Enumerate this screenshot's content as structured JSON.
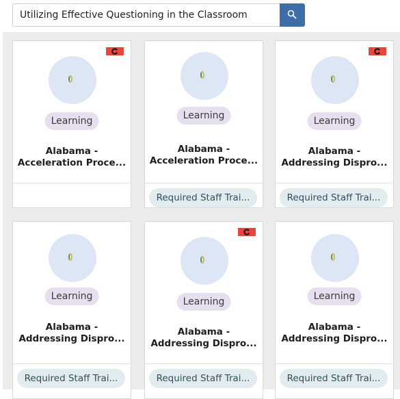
{
  "search": {
    "value": "Utilizing Effective Questioning in the Classroom",
    "button_icon": "search-icon"
  },
  "flag_icon": "refresh-icon",
  "colors": {
    "accent": "#3e6ea7",
    "flag": "#e8453c",
    "learning_badge": "#e6dff0",
    "tag": "#e2ecef"
  },
  "cards": [
    {
      "badge": "Learning",
      "title_line1": "Alabama -",
      "title_line2": "Acceleration Proce...",
      "tag": ""
    },
    {
      "badge": "Learning",
      "title_line1": "Alabama -",
      "title_line2": "Acceleration Proce...",
      "tag": "Required Staff Trai..."
    },
    {
      "badge": "Learning",
      "title_line1": "Alabama -",
      "title_line2": "Addressing Dispro...",
      "tag": "Required Staff Trai..."
    },
    {
      "badge": "Learning",
      "title_line1": "Alabama -",
      "title_line2": "Addressing Dispro...",
      "tag": "Required Staff Trai..."
    },
    {
      "badge": "Learning",
      "title_line1": "Alabama -",
      "title_line2": "Addressing Dispro...",
      "tag": "Required Staff Trai..."
    },
    {
      "badge": "Learning",
      "title_line1": "Alabama -",
      "title_line2": "Addressing Dispro...",
      "tag": "Required Staff Trai..."
    }
  ]
}
